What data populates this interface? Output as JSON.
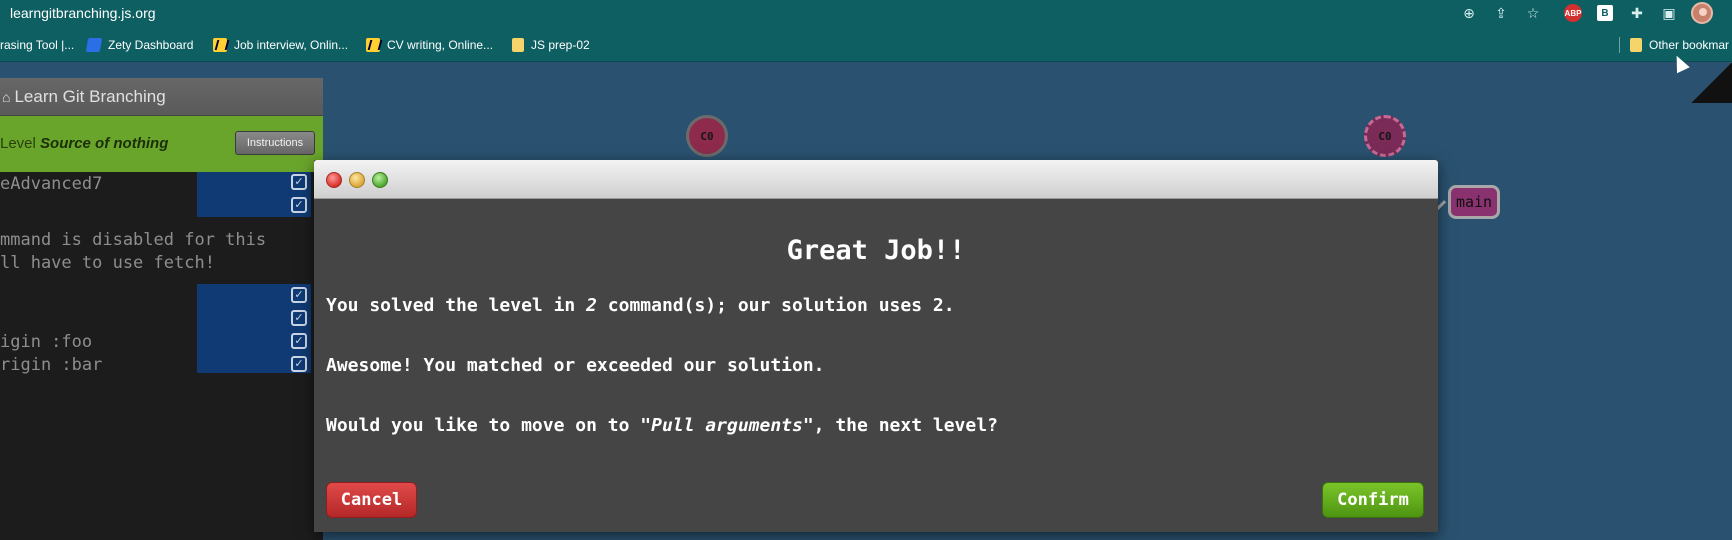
{
  "browser": {
    "url": "learngitbranching.js.org",
    "toolbar_icons": [
      "zoom-icon",
      "share-icon",
      "star-icon",
      "abp-extension-icon",
      "b-extension-icon",
      "puzzle-extensions-icon",
      "side-panel-icon",
      "profile-avatar"
    ],
    "abp_label": "ABP",
    "b_ext_label": "B",
    "bookmarks": [
      {
        "label": "rasing Tool |...",
        "icon": "generic"
      },
      {
        "label": "Zety Dashboard",
        "icon": "zety-icon"
      },
      {
        "label": "Job interview, Onlin...",
        "icon": "miro-icon"
      },
      {
        "label": "CV writing, Online...",
        "icon": "miro-icon"
      },
      {
        "label": "JS prep-02",
        "icon": "folder-icon"
      }
    ],
    "other_bookmarks": "Other bookmar"
  },
  "panel": {
    "title": "Learn Git Branching",
    "level_prefix": "Level",
    "level_name": "Source of nothing",
    "instructions_label": "Instructions",
    "terminal_lines": [
      "eAdvanced7",
      "mmand is disabled for this",
      "ll have to use fetch!",
      "igin :foo",
      "rigin :bar"
    ]
  },
  "graph": {
    "local_commit": "C0",
    "remote_commit": "C0",
    "branch": "main"
  },
  "dialog": {
    "heading": "Great Job!!",
    "line1_pre": "You solved the level in ",
    "line1_count": "2",
    "line1_post": " command(s); our solution uses 2.",
    "line2": "Awesome! You matched or exceeded our solution.",
    "line3_pre": "Would you like to move on to ",
    "line3_level": "\"Pull arguments\"",
    "line3_post": ", the next level?",
    "cancel_label": "Cancel",
    "confirm_label": "Confirm"
  },
  "colors": {
    "chrome_teal": "#0e5f62",
    "canvas_blue": "#2a5270",
    "level_green": "#6aa52b",
    "cancel_red": "#c23434",
    "confirm_green": "#63ac1d"
  }
}
